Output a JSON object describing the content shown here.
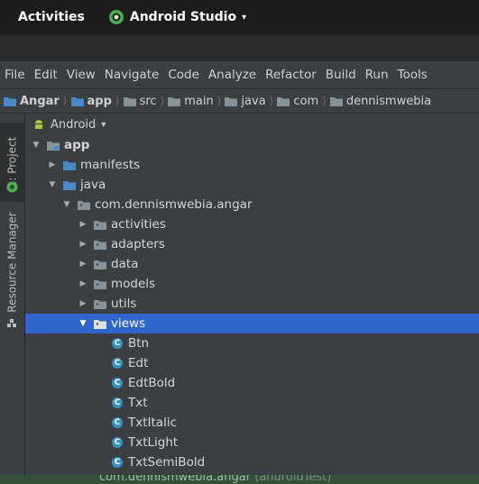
{
  "top_bar": {
    "activities": "Activities",
    "app_name": "Android Studio",
    "caret": "▾"
  },
  "menu": [
    "File",
    "Edit",
    "View",
    "Navigate",
    "Code",
    "Analyze",
    "Refactor",
    "Build",
    "Run",
    "Tools"
  ],
  "breadcrumb": [
    "Angar",
    "app",
    "src",
    "main",
    "java",
    "com",
    "dennismwebia"
  ],
  "sidebar": {
    "tab_project": "1: Project",
    "tab_resource": "Resource Manager"
  },
  "panel": {
    "view_selector": "Android",
    "caret": "▾"
  },
  "tree": [
    {
      "label": "app",
      "depth": 0,
      "arrow": "▼",
      "icon": "module-folder",
      "bold": true
    },
    {
      "label": "manifests",
      "depth": 1,
      "arrow": "▶",
      "icon": "folder"
    },
    {
      "label": "java",
      "depth": 1,
      "arrow": "▼",
      "icon": "folder"
    },
    {
      "label": "com.dennismwebia.angar",
      "depth": 2,
      "arrow": "▼",
      "icon": "package"
    },
    {
      "label": "activities",
      "depth": 3,
      "arrow": "▶",
      "icon": "package"
    },
    {
      "label": "adapters",
      "depth": 3,
      "arrow": "▶",
      "icon": "package"
    },
    {
      "label": "data",
      "depth": 3,
      "arrow": "▶",
      "icon": "package"
    },
    {
      "label": "models",
      "depth": 3,
      "arrow": "▶",
      "icon": "package"
    },
    {
      "label": "utils",
      "depth": 3,
      "arrow": "▶",
      "icon": "package"
    },
    {
      "label": "views",
      "depth": 3,
      "arrow": "▼",
      "icon": "package",
      "selected": true
    },
    {
      "label": "Btn",
      "depth": 4,
      "icon": "class"
    },
    {
      "label": "Edt",
      "depth": 4,
      "icon": "class"
    },
    {
      "label": "EdtBold",
      "depth": 4,
      "icon": "class"
    },
    {
      "label": "Txt",
      "depth": 4,
      "icon": "class"
    },
    {
      "label": "TxtItalic",
      "depth": 4,
      "icon": "class"
    },
    {
      "label": "TxtLight",
      "depth": 4,
      "icon": "class"
    },
    {
      "label": "TxtSemiBold",
      "depth": 4,
      "icon": "class"
    }
  ],
  "partial_row": {
    "label": "com.dennismwebia.angar",
    "suffix": "(androidTest)"
  },
  "colors": {
    "selection": "#2f65ca",
    "folder": "#87939a",
    "module": "#4a88c7",
    "class_icon": "#3592c4",
    "android_green": "#a4c639"
  }
}
